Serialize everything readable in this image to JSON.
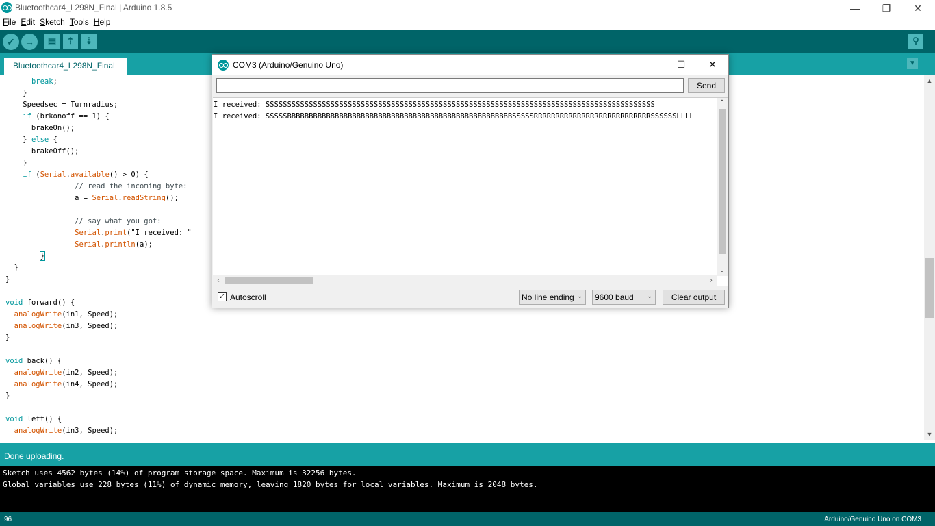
{
  "window": {
    "title": "Bluetoothcar4_L298N_Final | Arduino 1.8.5",
    "minimize": "—",
    "restore": "❐",
    "close": "✕"
  },
  "menu": [
    "File",
    "Edit",
    "Sketch",
    "Tools",
    "Help"
  ],
  "toolbar": {
    "verify_icon": "✓",
    "upload_icon": "→",
    "new_icon": "▤",
    "open_icon": "⇡",
    "save_icon": "⇣",
    "serial_monitor_icon": "⚲"
  },
  "tab": {
    "label": "Bluetoothcar4_L298N_Final",
    "menu_icon": "▼"
  },
  "code_lines": [
    "      break;",
    "    }",
    "    Speedsec = Turnradius;",
    "    if (brkonoff == 1) {",
    "      brakeOn();",
    "    } else {",
    "      brakeOff();",
    "    }",
    "    if (Serial.available() > 0) {",
    "                // read the incoming byte:",
    "                a = Serial.readString();",
    "",
    "                // say what you got:",
    "                Serial.print(\"I received: \"",
    "                Serial.println(a);",
    "        }",
    "  }",
    "}",
    "",
    "void forward() {",
    "  analogWrite(in1, Speed);",
    "  analogWrite(in3, Speed);",
    "}",
    "",
    "void back() {",
    "  analogWrite(in2, Speed);",
    "  analogWrite(in4, Speed);",
    "}",
    "",
    "void left() {",
    "  analogWrite(in3, Speed);"
  ],
  "status": {
    "message": "Done uploading."
  },
  "console_lines": [
    "Sketch uses 4562 bytes (14%) of program storage space. Maximum is 32256 bytes.",
    "Global variables use 228 bytes (11%) of dynamic memory, leaving 1820 bytes for local variables. Maximum is 2048 bytes."
  ],
  "footer": {
    "line_number": "96",
    "board": "Arduino/Genuino Uno on COM3"
  },
  "serial_monitor": {
    "title": "COM3 (Arduino/Genuino Uno)",
    "input_value": "",
    "send_label": "Send",
    "output_lines": [
      "I received: SSSSSSSSSSSSSSSSSSSSSSSSSSSSSSSSSSSSSSSSSSSSSSSSSSSSSSSSSSSSSSSSSSSSSSSSSSSSSSSSSSSSSSSSSS",
      "I received: SSSSSBBBBBBBBBBBBBBBBBBBBBBBBBBBBBBBBBBBBBBBBBBBBBBBBBBBBSSSSSRRRRRRRRRRRRRRRRRRRRRRRRRRRSSSSSSLLLL"
    ],
    "autoscroll_label": "Autoscroll",
    "autoscroll_checked": true,
    "line_ending": "No line ending",
    "baud": "9600 baud",
    "clear_label": "Clear output"
  }
}
